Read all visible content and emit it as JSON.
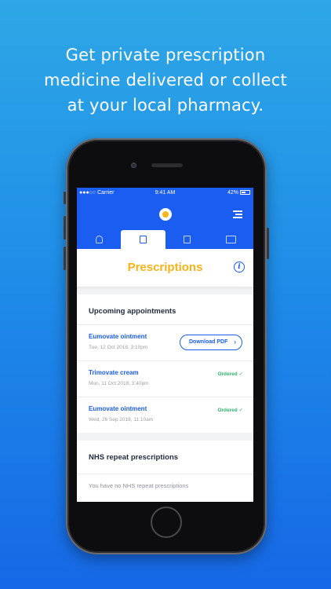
{
  "headline": {
    "line1": "Get private prescription",
    "line2": "medicine delivered or collect",
    "line3": "at your local pharmacy."
  },
  "status_bar": {
    "carrier": "●●●○○ Carrier",
    "time": "9:41 AM",
    "battery": "42%"
  },
  "header": {
    "tabs": [
      {
        "icon": "doctor-icon"
      },
      {
        "icon": "prescription-icon"
      },
      {
        "icon": "document-icon"
      },
      {
        "icon": "book-icon"
      }
    ],
    "active_tab": 1
  },
  "page": {
    "title": "Prescriptions"
  },
  "upcoming": {
    "title": "Upcoming appointments",
    "rows": [
      {
        "name": "Eumovate ointment",
        "date": "Tue, 12 Oct 2018, 3:10pm",
        "action": "Download PDF"
      },
      {
        "name": "Trimovate cream",
        "date": "Mon, 11 Oct 2018, 3:40pm",
        "status": "Ordered ✓"
      },
      {
        "name": "Eumovate ointment",
        "date": "Wed, 26 Sep 2018, 11:10am",
        "status": "Ordered ✓"
      }
    ]
  },
  "nhs": {
    "title": "NHS repeat prescriptions",
    "empty": "You have no NHS repeat prescriptions"
  },
  "colors": {
    "brand_blue": "#1a5df0",
    "title_yellow": "#f7b219",
    "ordered_green": "#2db56e"
  }
}
